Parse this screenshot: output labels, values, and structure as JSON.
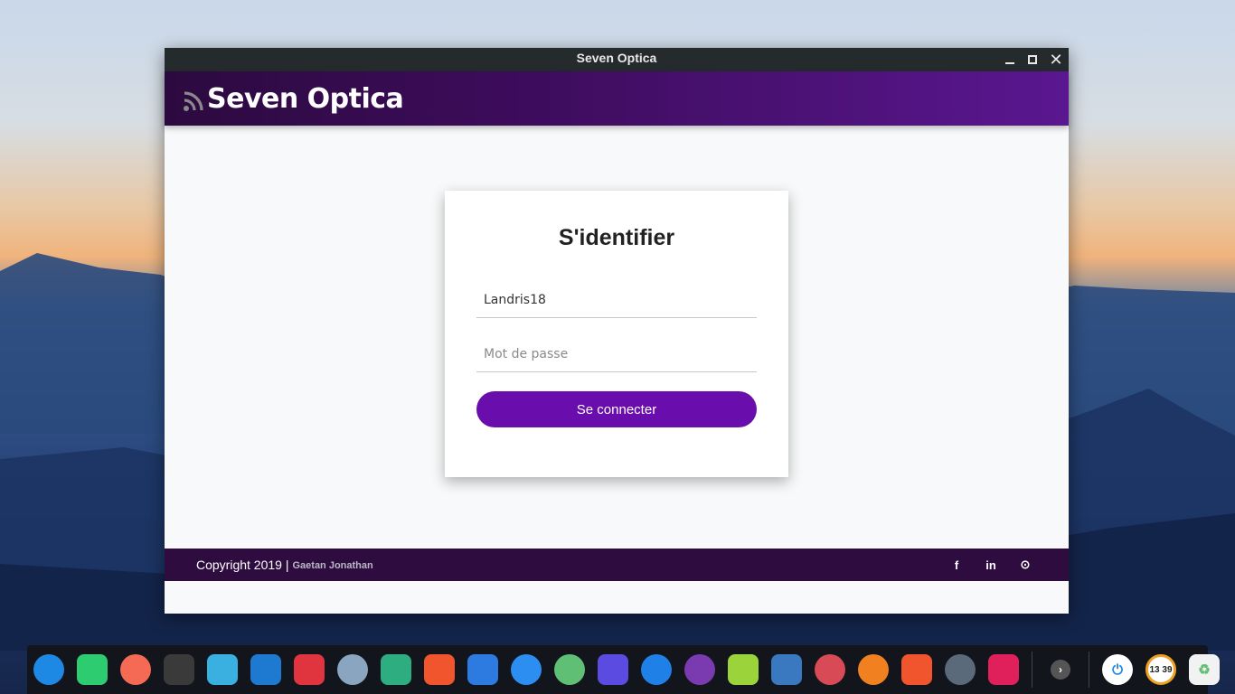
{
  "window": {
    "title": "Seven Optica",
    "brand": "Seven Optica"
  },
  "login": {
    "heading": "S'identifier",
    "username_value": "Landris18",
    "password_placeholder": "Mot de passe",
    "submit_label": "Se connecter"
  },
  "footer": {
    "copyright": "Copyright 2019 |",
    "author": "Gaetan Jonathan",
    "social": [
      {
        "icon": "facebook-icon",
        "glyph": "f"
      },
      {
        "icon": "linkedin-icon",
        "glyph": "in"
      },
      {
        "icon": "github-icon",
        "glyph": "⊙"
      }
    ]
  },
  "colors": {
    "accent": "#6a0dad",
    "header_start": "#2c0a3f",
    "header_end": "#5a1790",
    "footer": "#2e0c40"
  },
  "dock": {
    "items": [
      {
        "icon": "deepin-launcher-icon",
        "color": "#1e88e5"
      },
      {
        "icon": "file-manager-icon",
        "color": "#2ecc71"
      },
      {
        "icon": "app-store-icon",
        "color": "#f46a54"
      },
      {
        "icon": "terminal-icon",
        "color": "#3a3a3a"
      },
      {
        "icon": "archive-icon",
        "color": "#3ab0e0"
      },
      {
        "icon": "vscode-icon",
        "color": "#1e7ad0"
      },
      {
        "icon": "terminal-red-icon",
        "color": "#e0353e"
      },
      {
        "icon": "chromium-icon",
        "color": "#8aa5c0"
      },
      {
        "icon": "manjaro-icon",
        "color": "#2eae80"
      },
      {
        "icon": "brave-icon",
        "color": "#f0552e"
      },
      {
        "icon": "video-editor-icon",
        "color": "#2d7be0"
      },
      {
        "icon": "messenger-icon",
        "color": "#2b8ef0"
      },
      {
        "icon": "atom-green-icon",
        "color": "#5fbf74"
      },
      {
        "icon": "writer-icon",
        "color": "#5c4be0"
      },
      {
        "icon": "firefox-dev-icon",
        "color": "#1f80e8"
      },
      {
        "icon": "tor-browser-icon",
        "color": "#7a3bb0"
      },
      {
        "icon": "music-player-icon",
        "color": "#9bd43a"
      },
      {
        "icon": "download-icon",
        "color": "#3a78c0"
      },
      {
        "icon": "settings-icon",
        "color": "#d84a56"
      },
      {
        "icon": "firefox-icon",
        "color": "#f08020"
      },
      {
        "icon": "brave-2-icon",
        "color": "#f0552e"
      },
      {
        "icon": "atom-icon",
        "color": "#5b6a7b"
      },
      {
        "icon": "screenshot-icon",
        "color": "#e0205a"
      }
    ],
    "time": "13 39"
  }
}
